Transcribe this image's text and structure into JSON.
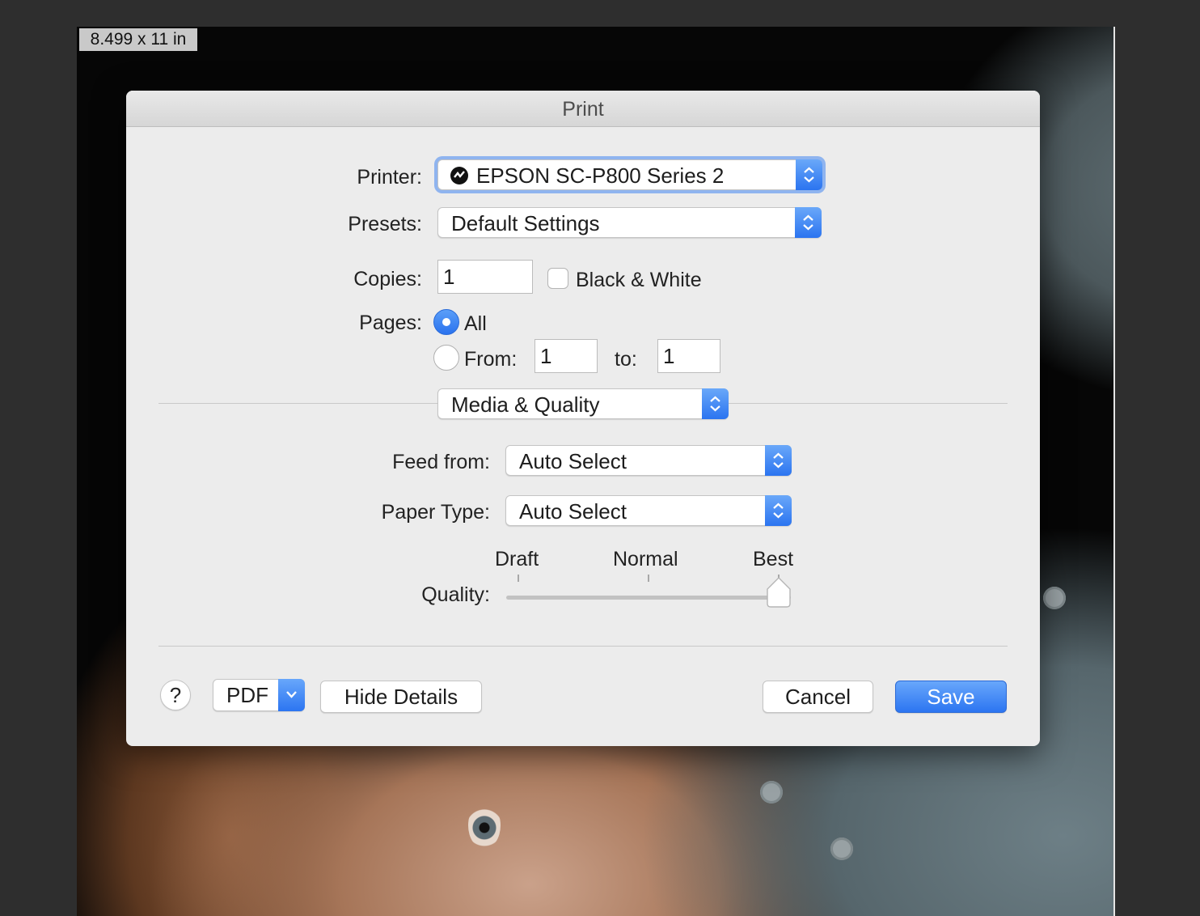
{
  "document": {
    "size_label": "8.499 x 11 in"
  },
  "dialog": {
    "title": "Print",
    "printer": {
      "label": "Printer:",
      "value": "EPSON SC-P800 Series 2"
    },
    "presets": {
      "label": "Presets:",
      "value": "Default Settings"
    },
    "copies": {
      "label": "Copies:",
      "value": "1"
    },
    "black_white": {
      "label": "Black & White",
      "checked": false
    },
    "pages": {
      "label": "Pages:",
      "all_label": "All",
      "from_label": "From:",
      "from_value": "1",
      "to_label": "to:",
      "to_value": "1",
      "selected": "All"
    },
    "section_popup": {
      "value": "Media & Quality"
    },
    "feed_from": {
      "label": "Feed from:",
      "value": "Auto Select"
    },
    "paper_type": {
      "label": "Paper Type:",
      "value": "Auto Select"
    },
    "quality": {
      "label": "Quality:",
      "ticks": [
        "Draft",
        "Normal",
        "Best"
      ],
      "value": "Best"
    },
    "footer": {
      "help_label": "?",
      "pdf_label": "PDF",
      "hide_details_label": "Hide Details",
      "cancel_label": "Cancel",
      "save_label": "Save"
    }
  },
  "icons": {
    "printer_status": "printer-status-icon",
    "stepper": "up-down-stepper-icon",
    "chevron": "chevron-down-icon"
  },
  "colors": {
    "accent": "#2c75f1",
    "dialog_bg": "#ececec",
    "backdrop": "#2e2e2e"
  }
}
